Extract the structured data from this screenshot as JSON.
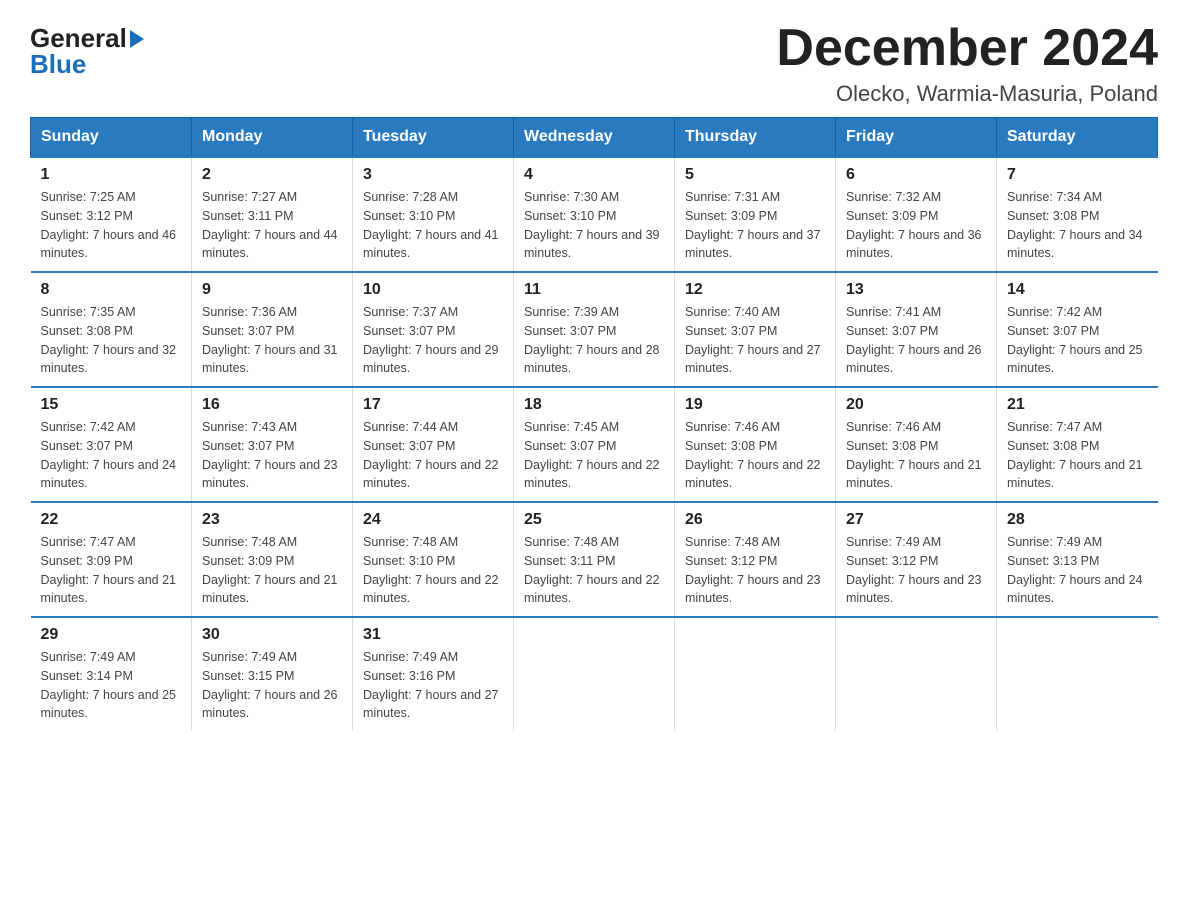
{
  "logo": {
    "general": "General",
    "blue": "Blue"
  },
  "title": "December 2024",
  "subtitle": "Olecko, Warmia-Masuria, Poland",
  "days_of_week": [
    "Sunday",
    "Monday",
    "Tuesday",
    "Wednesday",
    "Thursday",
    "Friday",
    "Saturday"
  ],
  "weeks": [
    [
      {
        "day": "1",
        "sunrise": "7:25 AM",
        "sunset": "3:12 PM",
        "daylight": "7 hours and 46 minutes."
      },
      {
        "day": "2",
        "sunrise": "7:27 AM",
        "sunset": "3:11 PM",
        "daylight": "7 hours and 44 minutes."
      },
      {
        "day": "3",
        "sunrise": "7:28 AM",
        "sunset": "3:10 PM",
        "daylight": "7 hours and 41 minutes."
      },
      {
        "day": "4",
        "sunrise": "7:30 AM",
        "sunset": "3:10 PM",
        "daylight": "7 hours and 39 minutes."
      },
      {
        "day": "5",
        "sunrise": "7:31 AM",
        "sunset": "3:09 PM",
        "daylight": "7 hours and 37 minutes."
      },
      {
        "day": "6",
        "sunrise": "7:32 AM",
        "sunset": "3:09 PM",
        "daylight": "7 hours and 36 minutes."
      },
      {
        "day": "7",
        "sunrise": "7:34 AM",
        "sunset": "3:08 PM",
        "daylight": "7 hours and 34 minutes."
      }
    ],
    [
      {
        "day": "8",
        "sunrise": "7:35 AM",
        "sunset": "3:08 PM",
        "daylight": "7 hours and 32 minutes."
      },
      {
        "day": "9",
        "sunrise": "7:36 AM",
        "sunset": "3:07 PM",
        "daylight": "7 hours and 31 minutes."
      },
      {
        "day": "10",
        "sunrise": "7:37 AM",
        "sunset": "3:07 PM",
        "daylight": "7 hours and 29 minutes."
      },
      {
        "day": "11",
        "sunrise": "7:39 AM",
        "sunset": "3:07 PM",
        "daylight": "7 hours and 28 minutes."
      },
      {
        "day": "12",
        "sunrise": "7:40 AM",
        "sunset": "3:07 PM",
        "daylight": "7 hours and 27 minutes."
      },
      {
        "day": "13",
        "sunrise": "7:41 AM",
        "sunset": "3:07 PM",
        "daylight": "7 hours and 26 minutes."
      },
      {
        "day": "14",
        "sunrise": "7:42 AM",
        "sunset": "3:07 PM",
        "daylight": "7 hours and 25 minutes."
      }
    ],
    [
      {
        "day": "15",
        "sunrise": "7:42 AM",
        "sunset": "3:07 PM",
        "daylight": "7 hours and 24 minutes."
      },
      {
        "day": "16",
        "sunrise": "7:43 AM",
        "sunset": "3:07 PM",
        "daylight": "7 hours and 23 minutes."
      },
      {
        "day": "17",
        "sunrise": "7:44 AM",
        "sunset": "3:07 PM",
        "daylight": "7 hours and 22 minutes."
      },
      {
        "day": "18",
        "sunrise": "7:45 AM",
        "sunset": "3:07 PM",
        "daylight": "7 hours and 22 minutes."
      },
      {
        "day": "19",
        "sunrise": "7:46 AM",
        "sunset": "3:08 PM",
        "daylight": "7 hours and 22 minutes."
      },
      {
        "day": "20",
        "sunrise": "7:46 AM",
        "sunset": "3:08 PM",
        "daylight": "7 hours and 21 minutes."
      },
      {
        "day": "21",
        "sunrise": "7:47 AM",
        "sunset": "3:08 PM",
        "daylight": "7 hours and 21 minutes."
      }
    ],
    [
      {
        "day": "22",
        "sunrise": "7:47 AM",
        "sunset": "3:09 PM",
        "daylight": "7 hours and 21 minutes."
      },
      {
        "day": "23",
        "sunrise": "7:48 AM",
        "sunset": "3:09 PM",
        "daylight": "7 hours and 21 minutes."
      },
      {
        "day": "24",
        "sunrise": "7:48 AM",
        "sunset": "3:10 PM",
        "daylight": "7 hours and 22 minutes."
      },
      {
        "day": "25",
        "sunrise": "7:48 AM",
        "sunset": "3:11 PM",
        "daylight": "7 hours and 22 minutes."
      },
      {
        "day": "26",
        "sunrise": "7:48 AM",
        "sunset": "3:12 PM",
        "daylight": "7 hours and 23 minutes."
      },
      {
        "day": "27",
        "sunrise": "7:49 AM",
        "sunset": "3:12 PM",
        "daylight": "7 hours and 23 minutes."
      },
      {
        "day": "28",
        "sunrise": "7:49 AM",
        "sunset": "3:13 PM",
        "daylight": "7 hours and 24 minutes."
      }
    ],
    [
      {
        "day": "29",
        "sunrise": "7:49 AM",
        "sunset": "3:14 PM",
        "daylight": "7 hours and 25 minutes."
      },
      {
        "day": "30",
        "sunrise": "7:49 AM",
        "sunset": "3:15 PM",
        "daylight": "7 hours and 26 minutes."
      },
      {
        "day": "31",
        "sunrise": "7:49 AM",
        "sunset": "3:16 PM",
        "daylight": "7 hours and 27 minutes."
      },
      null,
      null,
      null,
      null
    ]
  ]
}
